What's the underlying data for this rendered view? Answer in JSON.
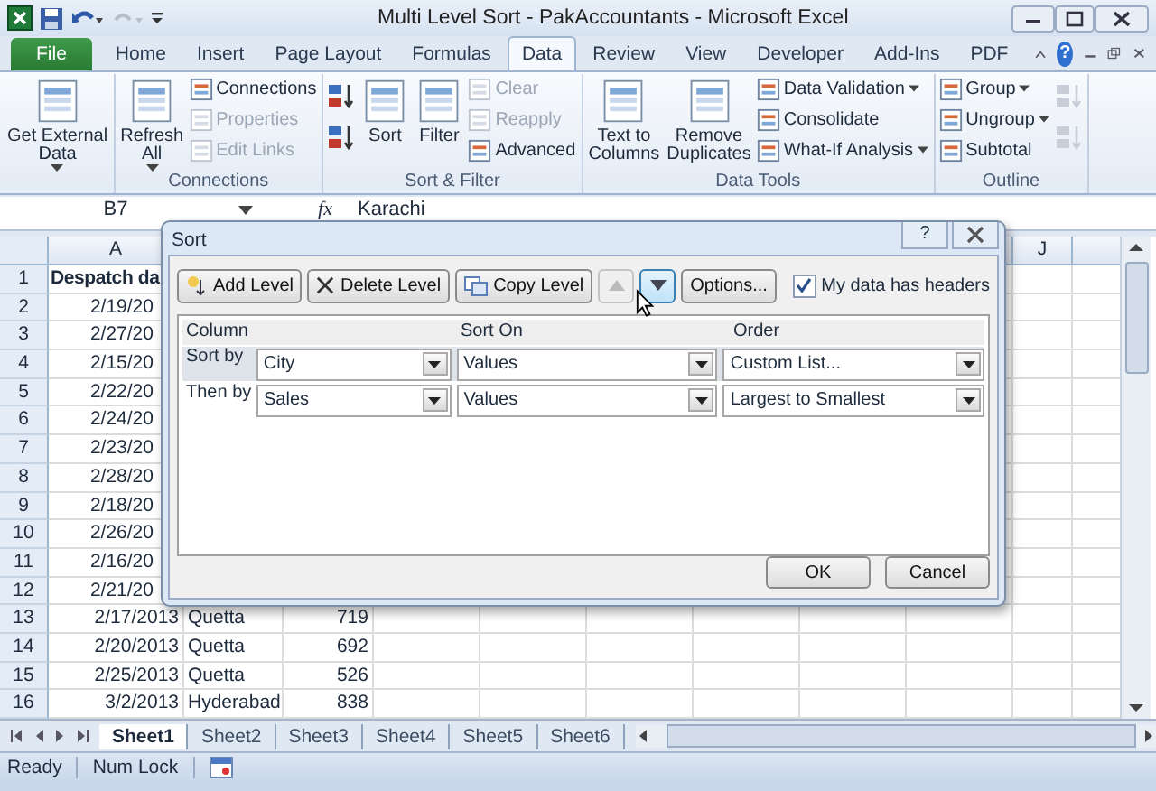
{
  "window": {
    "title": "Multi Level Sort - PakAccountants - Microsoft Excel",
    "help": "?"
  },
  "tabs": [
    {
      "label": "File",
      "kind": "file",
      "selected": false
    },
    {
      "label": "Home",
      "kind": "tab",
      "selected": false
    },
    {
      "label": "Insert",
      "kind": "tab",
      "selected": false
    },
    {
      "label": "Page Layout",
      "kind": "tab",
      "selected": false
    },
    {
      "label": "Formulas",
      "kind": "tab",
      "selected": false
    },
    {
      "label": "Data",
      "kind": "tab",
      "selected": true
    },
    {
      "label": "Review",
      "kind": "tab",
      "selected": false
    },
    {
      "label": "View",
      "kind": "tab",
      "selected": false
    },
    {
      "label": "Developer",
      "kind": "tab",
      "selected": false
    },
    {
      "label": "Add-Ins",
      "kind": "tab",
      "selected": false
    },
    {
      "label": "PDF",
      "kind": "tab",
      "selected": false
    }
  ],
  "ribbon_groups": [
    {
      "columns": [
        [
          {
            "kind": "large",
            "lines": [
              "Get External",
              "Data"
            ],
            "menu": true,
            "disabled": false
          }
        ]
      ]
    },
    {
      "title": "Connections",
      "columns": [
        [
          {
            "kind": "large",
            "lines": [
              "Refresh",
              "All"
            ],
            "menu": true,
            "disabled": false
          }
        ],
        [
          {
            "kind": "small",
            "label": "Connections",
            "menu": false,
            "disabled": false
          },
          {
            "kind": "small",
            "label": "Properties",
            "menu": false,
            "disabled": true
          },
          {
            "kind": "small",
            "label": "Edit Links",
            "menu": false,
            "disabled": true
          }
        ]
      ]
    },
    {
      "title": "Sort & Filter",
      "columns": [
        [
          {
            "kind": "icon",
            "disabled": false
          },
          {
            "kind": "icon",
            "disabled": false
          }
        ],
        [
          {
            "kind": "large",
            "lines": [
              "Sort"
            ],
            "menu": false,
            "disabled": false
          }
        ],
        [
          {
            "kind": "large",
            "lines": [
              "Filter"
            ],
            "menu": false,
            "disabled": false
          }
        ],
        [
          {
            "kind": "small",
            "label": "Clear",
            "menu": false,
            "disabled": true
          },
          {
            "kind": "small",
            "label": "Reapply",
            "menu": false,
            "disabled": true
          },
          {
            "kind": "small",
            "label": "Advanced",
            "menu": false,
            "disabled": false
          }
        ]
      ]
    },
    {
      "title": "Data Tools",
      "columns": [
        [
          {
            "kind": "large",
            "lines": [
              "Text to",
              "Columns"
            ],
            "menu": false,
            "disabled": false
          }
        ],
        [
          {
            "kind": "large",
            "lines": [
              "Remove",
              "Duplicates"
            ],
            "menu": false,
            "disabled": false
          }
        ],
        [
          {
            "kind": "small",
            "label": "Data Validation",
            "menu": true,
            "disabled": false
          },
          {
            "kind": "small",
            "label": "Consolidate",
            "menu": false,
            "disabled": false
          },
          {
            "kind": "small",
            "label": "What-If Analysis",
            "menu": true,
            "disabled": false
          }
        ]
      ]
    },
    {
      "title": "Outline",
      "columns": [
        [
          {
            "kind": "small",
            "label": "Group",
            "menu": true,
            "disabled": false
          },
          {
            "kind": "small",
            "label": "Ungroup",
            "menu": true,
            "disabled": false
          },
          {
            "kind": "small",
            "label": "Subtotal",
            "menu": false,
            "disabled": false
          }
        ],
        [
          {
            "kind": "icon",
            "disabled": true
          },
          {
            "kind": "icon",
            "disabled": true
          }
        ]
      ]
    }
  ],
  "formula_bar": {
    "name_box": "B7",
    "fx": "fx",
    "value": "Karachi"
  },
  "columns": [
    {
      "label": "A"
    },
    {},
    {},
    {},
    {},
    {},
    {},
    {},
    {},
    {
      "label": "J"
    },
    {}
  ],
  "rows": [
    {
      "n": "1",
      "a": "Despatch da",
      "header": true
    },
    {
      "n": "2",
      "a": "2/19/20",
      "header": false
    },
    {
      "n": "3",
      "a": "2/27/20",
      "header": false
    },
    {
      "n": "4",
      "a": "2/15/20",
      "header": false
    },
    {
      "n": "5",
      "a": "2/22/20",
      "header": false
    },
    {
      "n": "6",
      "a": "2/24/20",
      "header": false
    },
    {
      "n": "7",
      "a": "2/23/20",
      "header": false
    },
    {
      "n": "8",
      "a": "2/28/20",
      "header": false
    },
    {
      "n": "9",
      "a": "2/18/20",
      "header": false
    },
    {
      "n": "10",
      "a": "2/26/20",
      "header": false
    },
    {
      "n": "11",
      "a": "2/16/20",
      "header": false
    },
    {
      "n": "12",
      "a": "2/21/20",
      "header": false
    },
    {
      "n": "13",
      "a": "2/17/2013",
      "b": "Quetta",
      "c": "719",
      "header": false
    },
    {
      "n": "14",
      "a": "2/20/2013",
      "b": "Quetta",
      "c": "692",
      "header": false
    },
    {
      "n": "15",
      "a": "2/25/2013",
      "b": "Quetta",
      "c": "526",
      "header": false
    },
    {
      "n": "16",
      "a": "3/2/2013",
      "b": "Hyderabad",
      "c": "838",
      "header": false
    }
  ],
  "sheet_tabs": [
    {
      "label": "Sheet1",
      "selected": true
    },
    {
      "label": "Sheet2",
      "selected": false
    },
    {
      "label": "Sheet3",
      "selected": false
    },
    {
      "label": "Sheet4",
      "selected": false
    },
    {
      "label": "Sheet5",
      "selected": false
    },
    {
      "label": "Sheet6",
      "selected": false
    }
  ],
  "status_bar": [
    "Ready",
    "Num Lock"
  ],
  "dialog": {
    "title": "Sort",
    "help": "?",
    "toolbar": [
      {
        "kind": "add",
        "label": "Add Level",
        "disabled": false,
        "highlighted": false
      },
      {
        "kind": "delete",
        "label": "Delete Level",
        "disabled": false,
        "highlighted": false
      },
      {
        "kind": "copy",
        "label": "Copy Level",
        "disabled": false,
        "highlighted": false
      },
      {
        "kind": "up",
        "disabled": true,
        "highlighted": false
      },
      {
        "kind": "down",
        "disabled": false,
        "highlighted": true
      },
      {
        "kind": "options",
        "label": "Options...",
        "disabled": false,
        "highlighted": false
      }
    ],
    "headers_checkbox": {
      "label": "My data has headers",
      "checked": true
    },
    "table_headers": [
      "Column",
      "Sort On",
      "Order"
    ],
    "levels": [
      {
        "label": "Sort by",
        "column": "City",
        "sort_on": "Values",
        "order": "Custom List...",
        "selected": true
      },
      {
        "label": "Then by",
        "column": "Sales",
        "sort_on": "Values",
        "order": "Largest to Smallest",
        "selected": false
      }
    ],
    "buttons": [
      "OK",
      "Cancel"
    ]
  }
}
